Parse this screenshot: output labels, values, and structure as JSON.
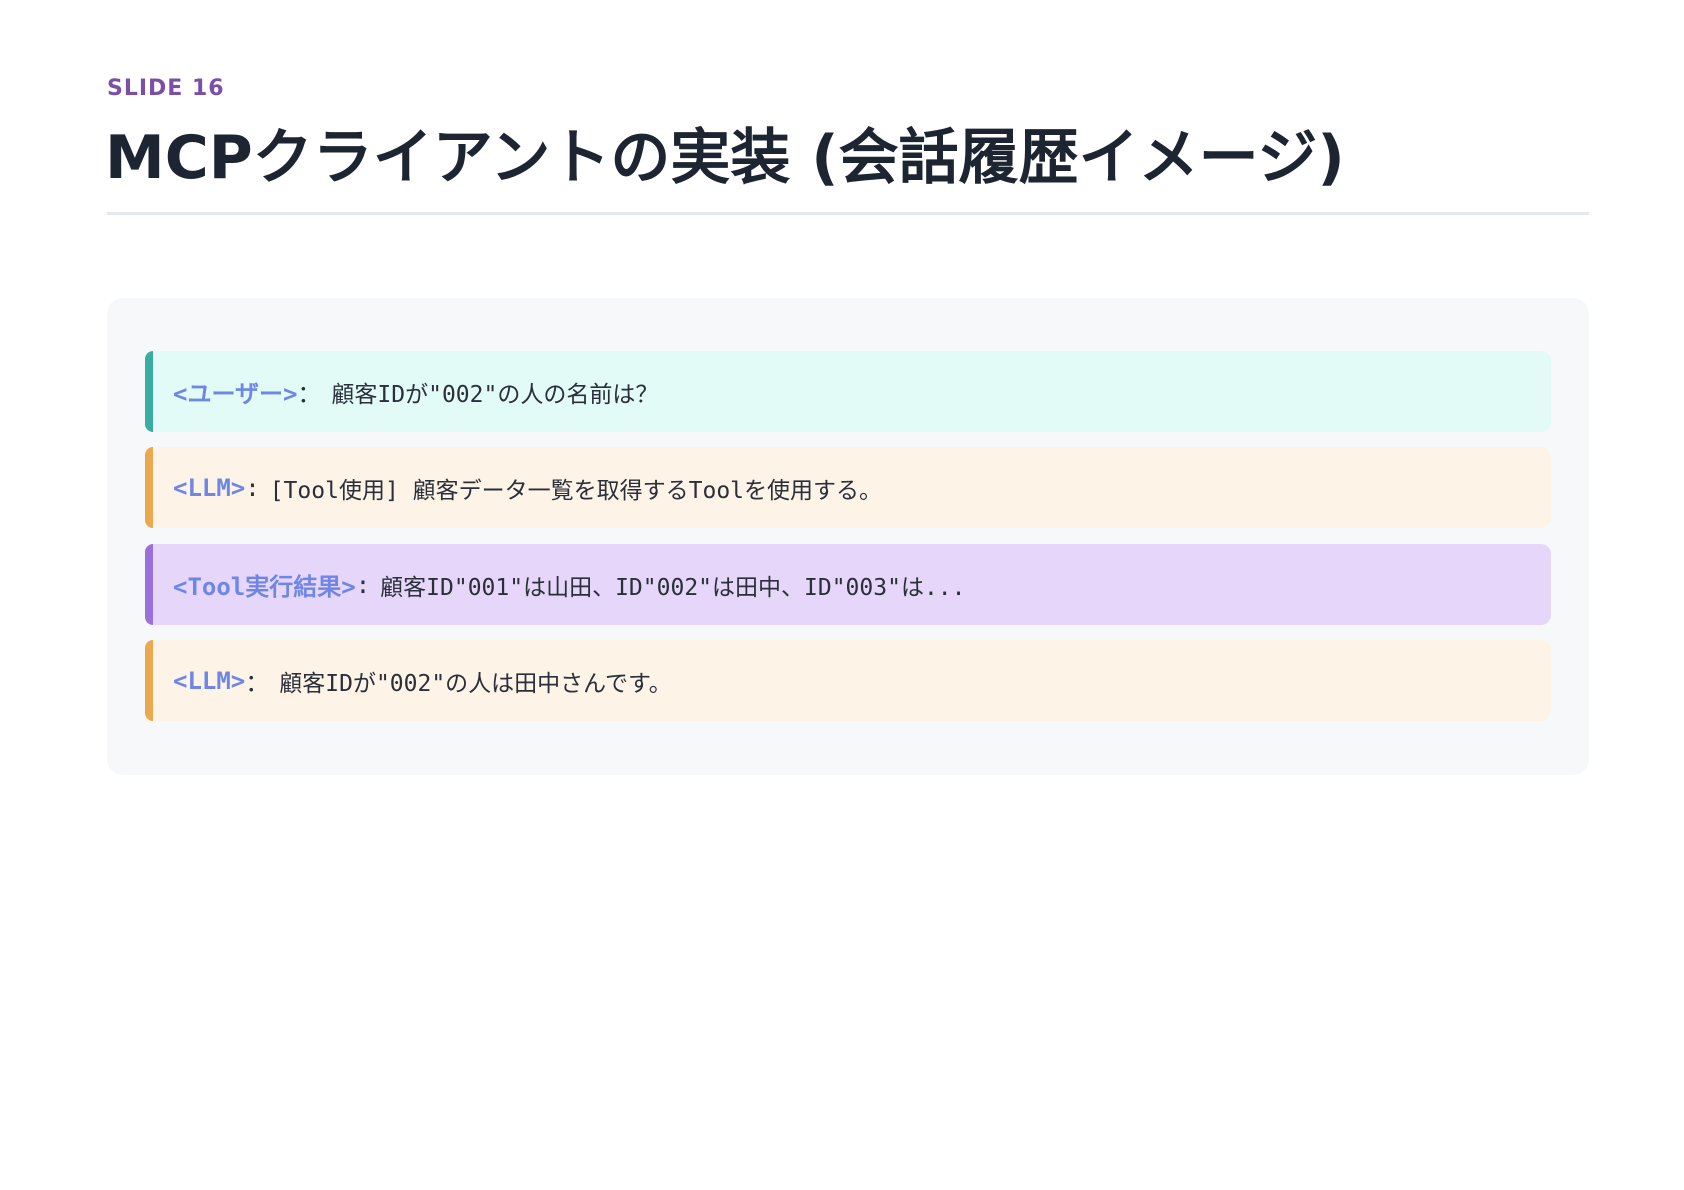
{
  "slide": {
    "label": "SLIDE 16",
    "title": "MCPクライアントの実装 (会話履歴イメージ)"
  },
  "messages": [
    {
      "speaker": "<ユーザー>",
      "separator": "：",
      "text": "顧客IDが\"002\"の人の名前は？"
    },
    {
      "speaker": "<LLM>",
      "separator": ":",
      "text": "[Tool使用] 顧客データ一覧を取得するToolを使用する。"
    },
    {
      "speaker": "<Tool実行結果>",
      "separator": ":",
      "text": "顧客ID\"001\"は山田、ID\"002\"は田中、ID\"003\"は..."
    },
    {
      "speaker": "<LLM>",
      "separator": "：",
      "text": "顧客IDが\"002\"の人は田中さんです。"
    }
  ],
  "colors": {
    "accent_purple": "#7b4fa8",
    "speaker_blue": "#6f86e6",
    "user_bar": "#3aada3",
    "llm_bar": "#eba84d",
    "tool_bar": "#9b6fdc"
  }
}
